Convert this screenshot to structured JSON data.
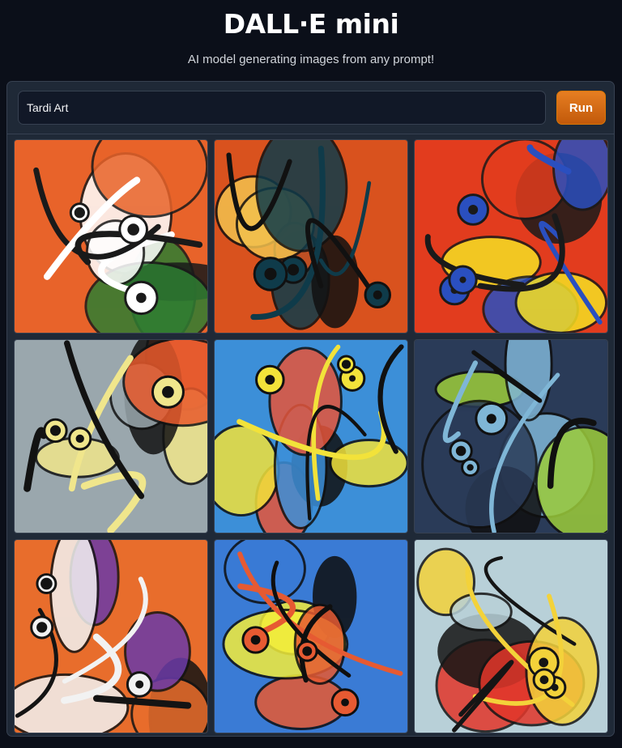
{
  "app": {
    "title": "DALL·E mini",
    "subtitle": "AI model generating images from any prompt!"
  },
  "prompt": {
    "value": "Tardi Art",
    "placeholder": ""
  },
  "run_button": {
    "label": "Run"
  },
  "gallery": {
    "images": [
      {
        "name": "generated-image-1",
        "bg": "#e8632a",
        "accent": "#2e7d32",
        "shape": "#ffffff",
        "dark": "#1a1a1a"
      },
      {
        "name": "generated-image-2",
        "bg": "#d9521e",
        "accent": "#f2c14e",
        "shape": "#0f3b4a",
        "dark": "#111111"
      },
      {
        "name": "generated-image-3",
        "bg": "#e23c1e",
        "accent": "#f5e023",
        "shape": "#2a4fbf",
        "dark": "#1a1a1a"
      },
      {
        "name": "generated-image-4",
        "bg": "#9aa7ad",
        "accent": "#e85a2c",
        "shape": "#f0e68c",
        "dark": "#121212"
      },
      {
        "name": "generated-image-5",
        "bg": "#3c8fd8",
        "accent": "#e6553a",
        "shape": "#f2e23a",
        "dark": "#111111"
      },
      {
        "name": "generated-image-6",
        "bg": "#2a3b58",
        "accent": "#9ccc3a",
        "shape": "#7fb6d6",
        "dark": "#101010"
      },
      {
        "name": "generated-image-7",
        "bg": "#e86d2c",
        "accent": "#6a3aa8",
        "shape": "#f2f2f2",
        "dark": "#141414"
      },
      {
        "name": "generated-image-8",
        "bg": "#3a7bd5",
        "accent": "#f4ee3a",
        "shape": "#e65a32",
        "dark": "#0f0f0f"
      },
      {
        "name": "generated-image-9",
        "bg": "#b8d0d8",
        "accent": "#e2362a",
        "shape": "#f3d23a",
        "dark": "#151515"
      }
    ]
  }
}
